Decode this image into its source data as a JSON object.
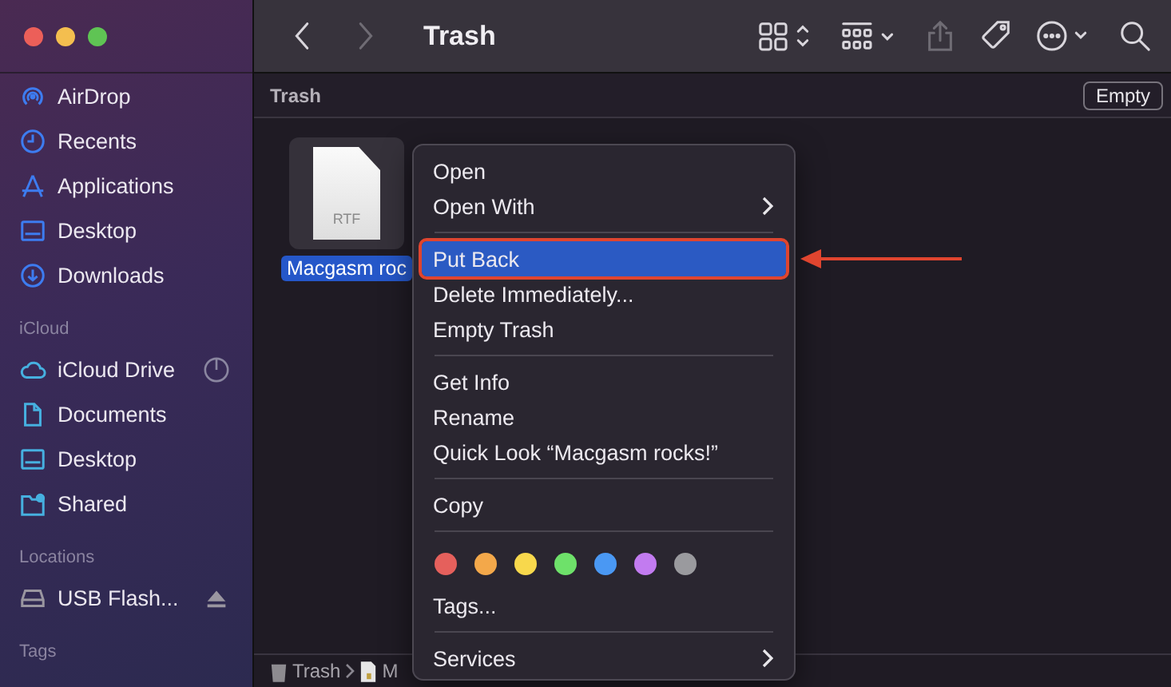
{
  "window": {
    "title": "Trash"
  },
  "toolbar": [
    {
      "disabled": false
    },
    {
      "disabled": true
    },
    {
      "disabled": false
    },
    {
      "disabled": false
    },
    {
      "disabled": true
    },
    {
      "disabled": false
    },
    {
      "disabled": false
    },
    {
      "disabled": false
    }
  ],
  "sidebar": {
    "sections": [
      {
        "items": [
          {
            "label": "AirDrop",
            "selected": false
          },
          {
            "label": "Recents",
            "selected": false
          },
          {
            "label": "Applications",
            "selected": false
          },
          {
            "label": "Desktop",
            "selected": false
          },
          {
            "label": "Downloads",
            "selected": false
          }
        ]
      },
      {
        "title": "iCloud",
        "items": [
          {
            "label": "iCloud Drive",
            "selected": false
          },
          {
            "label": "Documents",
            "selected": false
          },
          {
            "label": "Desktop",
            "selected": false
          },
          {
            "label": "Shared",
            "selected": false
          }
        ]
      },
      {
        "title": "Locations",
        "items": [
          {
            "label": "USB Flash...",
            "selected": false
          }
        ]
      },
      {
        "title": "Tags"
      }
    ]
  },
  "header": {
    "title": "Trash",
    "button": "Empty"
  },
  "files": [
    {
      "name": "Macgasm roc",
      "badge": "RTF",
      "selected": true
    }
  ],
  "context_menu": {
    "sections": [
      [
        {
          "kind": "item",
          "label": "Open",
          "selected": false
        },
        {
          "kind": "submenu",
          "label": "Open With",
          "selected": false
        }
      ],
      [
        {
          "kind": "item",
          "label": "Put Back",
          "selected": true,
          "outlined": true
        },
        {
          "kind": "item",
          "label": "Delete Immediately...",
          "selected": false
        },
        {
          "kind": "item",
          "label": "Empty Trash",
          "selected": false
        }
      ],
      [
        {
          "kind": "item",
          "label": "Get Info",
          "selected": false
        },
        {
          "kind": "item",
          "label": "Rename",
          "selected": false
        },
        {
          "kind": "item",
          "label": "Quick Look “Macgasm rocks!”",
          "selected": false
        }
      ],
      [
        {
          "kind": "item",
          "label": "Copy",
          "selected": false
        }
      ],
      [
        {
          "kind": "colors",
          "tags": [
            {
              "color": "#e5605c"
            },
            {
              "color": "#f3a84a"
            },
            {
              "color": "#f8d84c"
            },
            {
              "color": "#6ee16a"
            },
            {
              "color": "#4a98f3"
            },
            {
              "color": "#c27bf0"
            },
            {
              "color": "#9a9a9e"
            }
          ]
        },
        {
          "kind": "item",
          "label": "Tags...",
          "selected": false
        }
      ],
      [
        {
          "kind": "submenu",
          "label": "Services",
          "selected": false
        }
      ]
    ]
  },
  "path_bar": [
    {
      "label": "Trash"
    },
    {
      "label": "M"
    }
  ]
}
